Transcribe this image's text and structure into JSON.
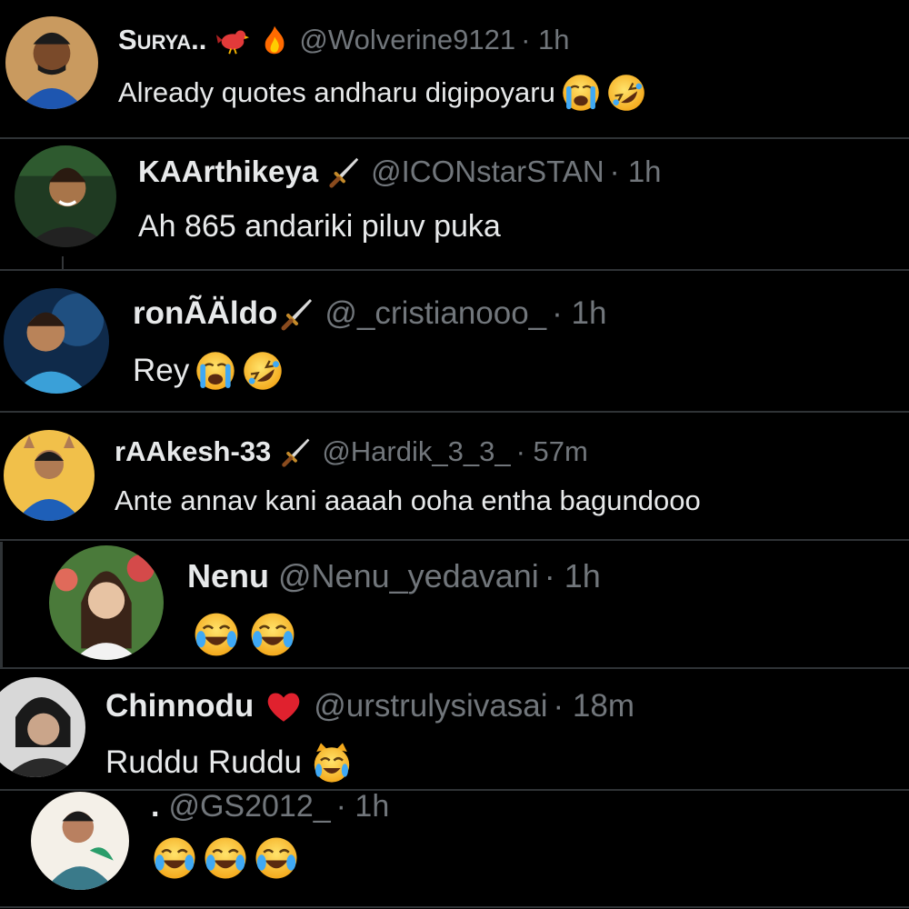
{
  "replies": [
    {
      "name": "Surya..",
      "handle": "@Wolverine9121",
      "time": "· 1h",
      "text": "Already quotes andharu digipoyaru",
      "name_icons": [
        "bird-icon",
        "fire-icon"
      ],
      "text_emojis": [
        "loudly-crying-face",
        "rolling-on-floor-laughing"
      ]
    },
    {
      "name": "KAArthikeya",
      "handle": "@ICONstarSTAN",
      "time": "· 1h",
      "text": "Ah 865 andariki piluv puka",
      "name_icons": [
        "dagger-icon"
      ],
      "text_emojis": []
    },
    {
      "name": "ronÃÄldo",
      "handle": "@_cristianooo_",
      "time": "· 1h",
      "text": "Rey",
      "name_icons": [
        "dagger-icon"
      ],
      "text_emojis": [
        "loudly-crying-face",
        "rolling-on-floor-laughing"
      ]
    },
    {
      "name": "rAAkesh-33",
      "handle": "@Hardik_3_3_",
      "time": "· 57m",
      "text": "Ante annav kani aaaah ooha entha bagundooo",
      "name_icons": [
        "dagger-icon"
      ],
      "text_emojis": []
    },
    {
      "name": "Nenu",
      "handle": "@Nenu_yedavani",
      "time": "· 1h",
      "text": "",
      "name_icons": [],
      "text_emojis": [
        "face-with-tears-of-joy",
        "face-with-tears-of-joy"
      ]
    },
    {
      "name": "Chinnodu",
      "handle": "@urstrulysivasai",
      "time": "· 18m",
      "text": "Ruddu Ruddu",
      "name_icons": [
        "red-heart-icon"
      ],
      "text_emojis": [
        "cat-with-tears-of-joy"
      ]
    },
    {
      "name": ".",
      "handle": "@GS2012_",
      "time": "· 1h",
      "text": "",
      "name_icons": [],
      "text_emojis": [
        "face-with-tears-of-joy",
        "face-with-tears-of-joy",
        "face-with-tears-of-joy"
      ]
    }
  ],
  "colors": {
    "background": "#000000",
    "name_text": "#e7e9ea",
    "handle_text": "#71767b",
    "separator": "#2f3336"
  }
}
